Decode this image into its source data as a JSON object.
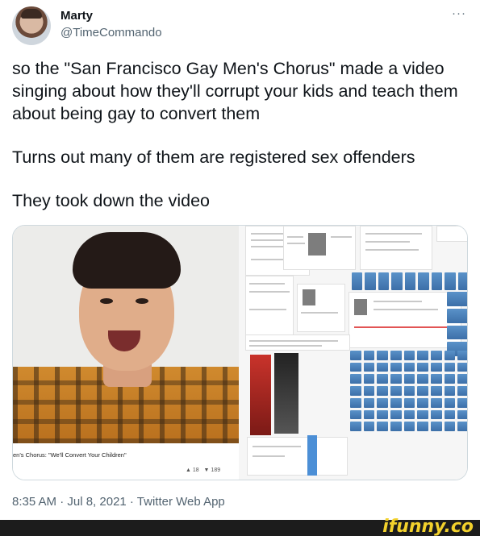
{
  "tweet": {
    "display_name": "Marty",
    "handle": "@TimeCommando",
    "more_label": "···",
    "paragraphs": [
      "so the \"San Francisco Gay Men's Chorus\" made a video singing about how they'll corrupt your kids and teach them about being gay to convert them",
      "Turns out many of them are registered sex offenders",
      "They took down the video"
    ],
    "timestamp": "8:35 AM · Jul 8, 2021 · Twitter Web App"
  },
  "media": {
    "video_caption": "en's Chorus: \"We'll Convert Your Children\"",
    "likes": "18",
    "dislikes": "189"
  },
  "watermark": "ifunny.co",
  "icons": {
    "like": "thumbs-up-icon",
    "dislike": "thumbs-down-icon"
  }
}
